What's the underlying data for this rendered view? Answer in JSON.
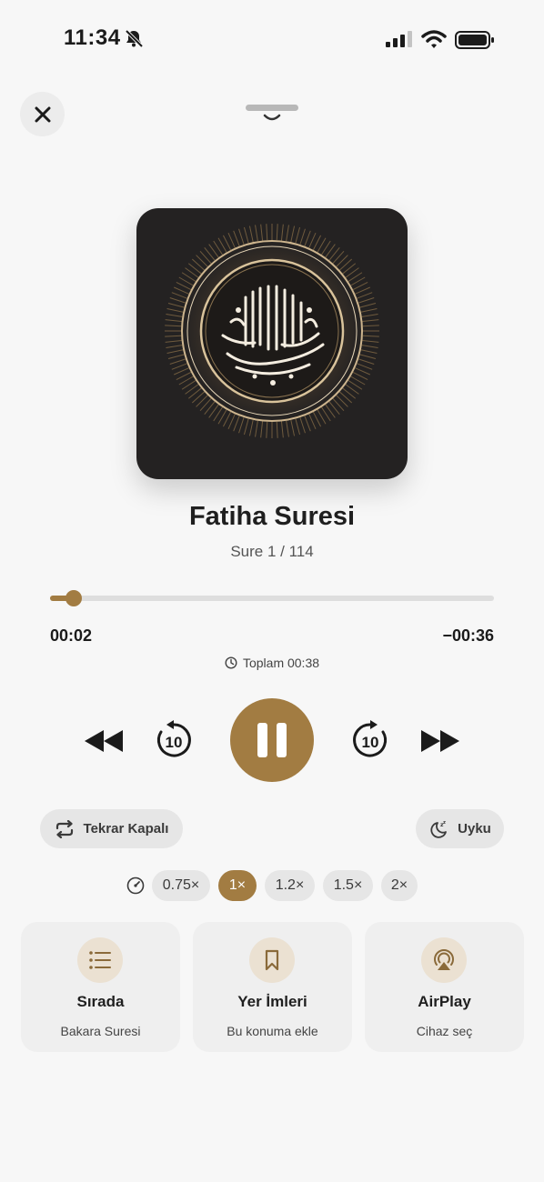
{
  "status_bar": {
    "time": "11:34"
  },
  "track": {
    "title": "Fatiha Suresi",
    "subtitle": "Sure 1 / 114"
  },
  "progress": {
    "elapsed": "00:02",
    "remaining": "−00:36",
    "total_label": "Toplam 00:38",
    "fraction": 0.053
  },
  "controls": {
    "skip_back_seconds": "10",
    "skip_forward_seconds": "10"
  },
  "repeat": {
    "label": "Tekrar Kapalı"
  },
  "sleep": {
    "label": "Uyku"
  },
  "speeds": {
    "options": [
      "0.75×",
      "1×",
      "1.2×",
      "1.5×",
      "2×"
    ],
    "selected": "1×"
  },
  "cards": [
    {
      "title": "Sırada",
      "subtitle": "Bakara Suresi",
      "icon": "list-icon"
    },
    {
      "title": "Yer İmleri",
      "subtitle": "Bu konuma ekle",
      "icon": "bookmark-icon"
    },
    {
      "title": "AirPlay",
      "subtitle": "Cihaz seç",
      "icon": "airplay-icon"
    }
  ],
  "colors": {
    "accent": "#a27c42",
    "artwork_bg": "#242222",
    "background": "#f7f7f7"
  }
}
